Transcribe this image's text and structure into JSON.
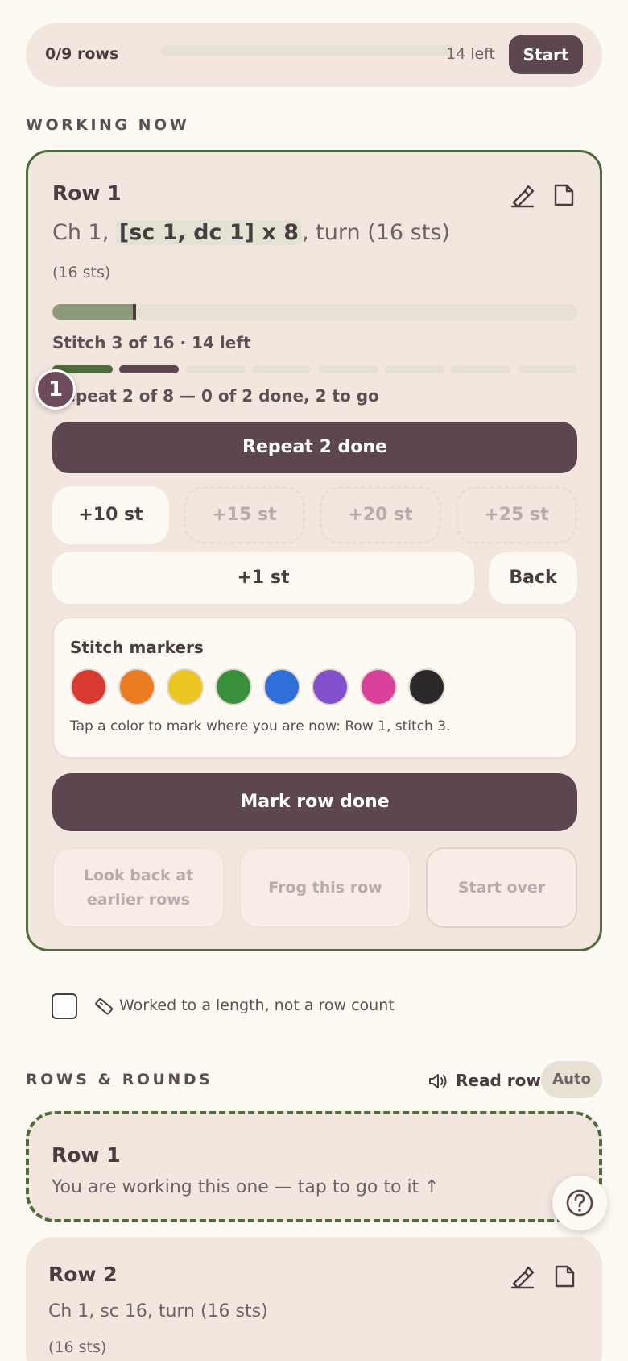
{
  "topbar": {
    "rows_label": "0/9 rows",
    "left_label": "14 left",
    "start_label": "Start",
    "progress": 0
  },
  "working_now": {
    "section_title": "WORKING NOW",
    "row_title": "Row 1",
    "instruction_pre": "Ch 1, ",
    "instruction_highlight": "[sc 1, dc 1] x 8",
    "instruction_post": ", turn (16 sts)",
    "stitch_total_note": "(16 sts)",
    "stitch_progress": {
      "current": 3,
      "total": 16
    },
    "stitch_status": "Stitch 3 of 16 · 14 left",
    "repeat_segments": [
      "done",
      "current",
      "todo",
      "todo",
      "todo",
      "todo",
      "todo",
      "todo"
    ],
    "repeat_badge": "1",
    "repeat_status": "Repeat 2 of 8 — 0 of 2 done, 2 to go",
    "repeat_button": "Repeat 2 done",
    "step_buttons": [
      {
        "label": "+10 st",
        "enabled": true
      },
      {
        "label": "+15 st",
        "enabled": false
      },
      {
        "label": "+20 st",
        "enabled": false
      },
      {
        "label": "+25 st",
        "enabled": false
      }
    ],
    "plus_one": "+1 st",
    "back": "Back",
    "markers": {
      "title": "Stitch markers",
      "colors": [
        "#d93a2f",
        "#ea7c21",
        "#ebc522",
        "#3a8f3a",
        "#2f6fd9",
        "#8350cb",
        "#d8409c",
        "#2b2829"
      ],
      "hint": "Tap a color to mark where you are now: Row 1, stitch 3."
    },
    "mark_row_done": "Mark row done",
    "look_back": "Look back at earlier rows",
    "frog": "Frog this row",
    "start_over": "Start over"
  },
  "length_option": {
    "checked": false,
    "label": "Worked to a length, not a row count"
  },
  "rows_rounds": {
    "section_title": "ROWS & ROUNDS",
    "read_row": "Read row",
    "auto": "Auto",
    "current_card": {
      "title": "Row 1",
      "desc": "You are working this one — tap to go to it ↑"
    },
    "rows": [
      {
        "title": "Row 2",
        "desc": "Ch 1, sc 16, turn (16 sts)",
        "sts": "(16 sts)"
      }
    ]
  }
}
